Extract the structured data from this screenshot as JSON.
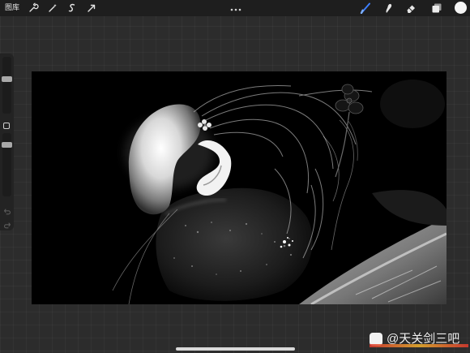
{
  "toolbar": {
    "gallery_label": "图库",
    "left_tools": [
      "wrench-icon",
      "magic-wand-icon",
      "selection-icon",
      "transform-arrow-icon"
    ],
    "right_tools": [
      "brush-icon",
      "smudge-icon",
      "eraser-icon",
      "layers-icon"
    ],
    "active_tool": "brush-icon",
    "accent_color": "#3d7fff",
    "current_color": "#f5f5f5"
  },
  "sidebar": {
    "brush_size_level": 0.15,
    "opacity_level": 0.55
  },
  "watermark": {
    "text": "@天关剑三吧"
  }
}
